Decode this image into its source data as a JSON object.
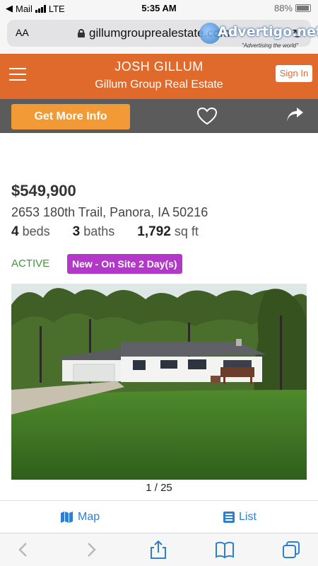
{
  "status_bar": {
    "carrier": "Mail",
    "network": "LTE",
    "time": "5:35 AM",
    "battery": "88%"
  },
  "browser": {
    "text_size_label": "AA",
    "url": "gillumgrouprealestate.com"
  },
  "watermark": {
    "brand": "Advertigo.net",
    "tagline": "\"Advertising the world\""
  },
  "site_header": {
    "agent_name": "JOSH GILLUM",
    "company_name": "Gillum Group Real Estate",
    "sign_in_label": "Sign In"
  },
  "action_bar": {
    "get_info_label": "Get More Info",
    "favorite_icon": "heart-icon",
    "share_icon": "share-icon"
  },
  "listing": {
    "price": "$549,900",
    "address": "2653 180th Trail, Panora, IA 50216",
    "beds_count": "4",
    "beds_label": "beds",
    "baths_count": "3",
    "baths_label": "baths",
    "sqft_count": "1,792",
    "sqft_label": "sq ft",
    "status": "ACTIVE",
    "badge": "New - On Site 2 Day(s)",
    "photo_counter": "1 / 25"
  },
  "view_bar": {
    "map_label": "Map",
    "list_label": "List"
  },
  "colors": {
    "header_orange": "#e06a2c",
    "button_orange": "#f19a36",
    "action_gray": "#5b5b5b",
    "badge_purple": "#b238c7",
    "active_green": "#3a9a3a",
    "link_blue": "#2f7fd0"
  }
}
